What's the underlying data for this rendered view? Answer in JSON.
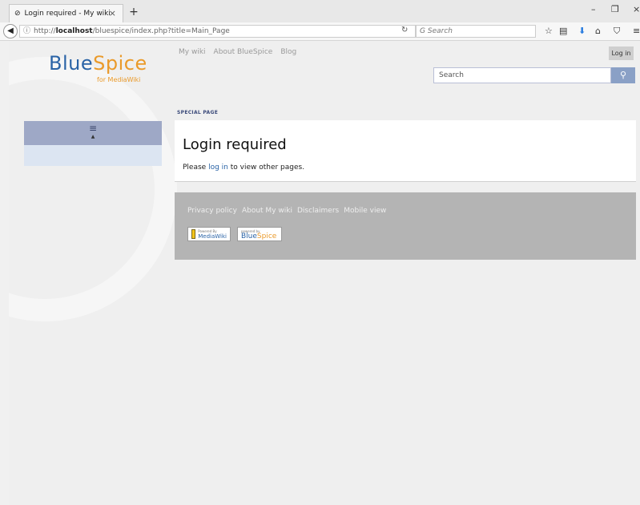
{
  "browser": {
    "tab_title": "Login required - My wiki",
    "tab_close": "×",
    "new_tab": "+",
    "url_prefix": "http://",
    "url_host": "localhost",
    "url_path": "/bluespice/index.php?title=Main_Page",
    "search_placeholder": "Search",
    "win_min": "–",
    "win_max": "❐",
    "win_close": "×"
  },
  "site": {
    "logo_main": "Blue",
    "logo_accent": "Spice",
    "logo_sub": "for MediaWiki",
    "nav": [
      "My wiki",
      "About BlueSpice",
      "Blog"
    ],
    "login_label": "Log in",
    "search_placeholder": "Search",
    "menu_icon": "≡",
    "menu_caret": "▲"
  },
  "content": {
    "label": "SPECIAL PAGE",
    "title": "Login required",
    "msg_before": "Please ",
    "msg_link": "log in",
    "msg_after": " to view other pages."
  },
  "footer": {
    "links": [
      "Privacy policy",
      "About My wiki",
      "Disclaimers",
      "Mobile view"
    ],
    "badge1_small": "Powered By",
    "badge1_main": "MediaWiki",
    "badge2_small": "powered by",
    "badge2_main": "Blue",
    "badge2_accent": "Spice"
  }
}
